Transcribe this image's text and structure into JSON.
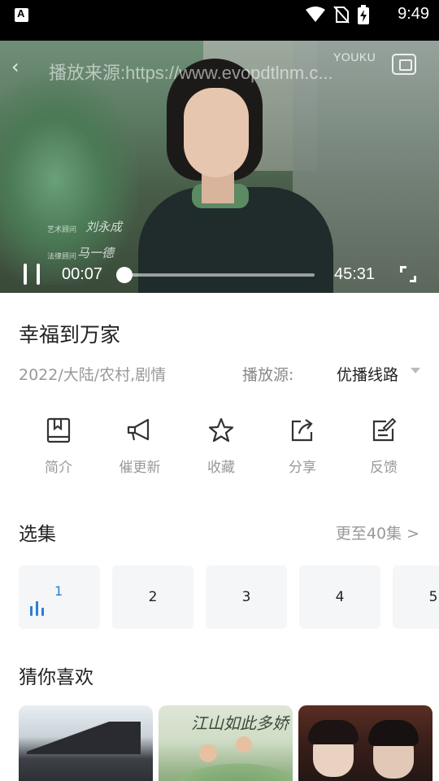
{
  "status_bar": {
    "time": "9:49",
    "icons": [
      "notification-a-icon",
      "wifi-icon",
      "no-sim-icon",
      "battery-charging-icon"
    ]
  },
  "player": {
    "watermark": "播放来源:https://www.evopdtlnm.c...",
    "logo": "YOUKU",
    "current_time": "00:07",
    "duration": "45:31",
    "progress": 0.0026,
    "credits": [
      "艺术顾问",
      "法律顾问"
    ],
    "credit_signatures": [
      "刘永成",
      "马一德"
    ]
  },
  "show": {
    "title": "幸福到万家",
    "meta": "2022/大陆/农村,剧情",
    "source_label": "播放源:",
    "source_value": "优播线路"
  },
  "actions": [
    {
      "label": "简介",
      "icon": "book-icon"
    },
    {
      "label": "催更新",
      "icon": "megaphone-icon"
    },
    {
      "label": "收藏",
      "icon": "star-icon"
    },
    {
      "label": "分享",
      "icon": "share-icon"
    },
    {
      "label": "反馈",
      "icon": "feedback-edit-icon"
    }
  ],
  "episodes_section": {
    "title": "选集",
    "more": "更至40集 >",
    "episodes": [
      "1",
      "2",
      "3",
      "4",
      "5"
    ],
    "active_index": 0
  },
  "recommend_section": {
    "title": "猜你喜欢",
    "poster_texts": [
      "江山如此多娇"
    ]
  },
  "colors": {
    "accent": "#2e7bd6",
    "status_bar": "#000000",
    "muted_text": "#999999",
    "episode_tile": "#f5f6f8"
  }
}
